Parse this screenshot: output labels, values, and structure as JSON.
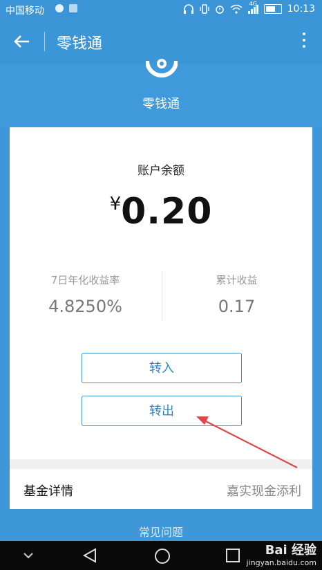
{
  "status_bar": {
    "carrier": "中国移动",
    "network": "4G",
    "time": "10:13"
  },
  "app_bar": {
    "title": "零钱通"
  },
  "hero": {
    "title": "零钱通"
  },
  "balance": {
    "label": "账户余额",
    "currency": "¥",
    "amount": "0.20"
  },
  "stats": [
    {
      "label": "7日年化收益率",
      "value": "4.8250%"
    },
    {
      "label": "累计收益",
      "value": "0.17"
    }
  ],
  "buttons": {
    "transfer_in": "转入",
    "transfer_out": "转出"
  },
  "fund": {
    "label": "基金详情",
    "value": "嘉实现金添利"
  },
  "footer": {
    "faq": "常见问题"
  },
  "watermark": {
    "brand": "Bai 经验",
    "url": "jingyan.baidu.com"
  },
  "colors": {
    "primary": "#3d97d8",
    "accent_border": "#3c8fc9",
    "arrow": "#e04848"
  }
}
